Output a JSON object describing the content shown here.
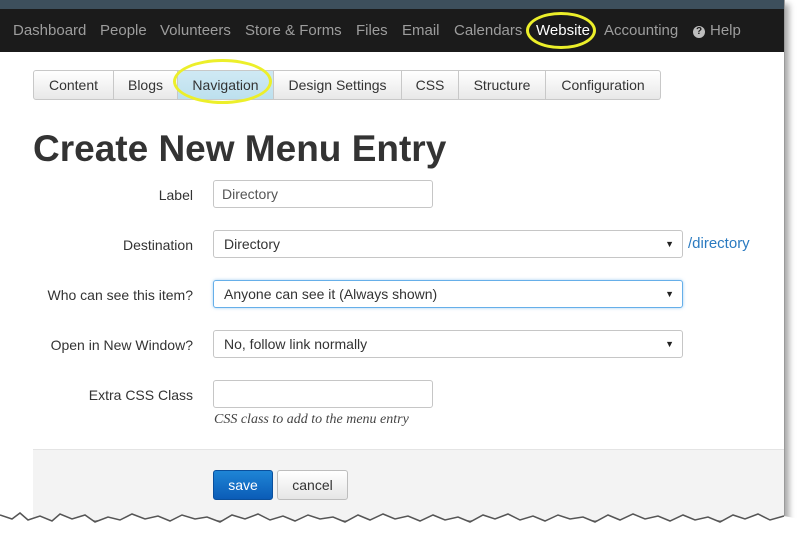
{
  "topnav": {
    "items": [
      "Dashboard",
      "People",
      "Volunteers",
      "Store & Forms",
      "Files",
      "Email",
      "Calendars",
      "Website",
      "Accounting",
      "Help"
    ]
  },
  "tabs": [
    "Content",
    "Blogs",
    "Navigation",
    "Design Settings",
    "CSS",
    "Structure",
    "Configuration"
  ],
  "page": {
    "title": "Create New Menu Entry"
  },
  "form": {
    "label": {
      "label": "Label",
      "value": "Directory"
    },
    "destination": {
      "label": "Destination",
      "value": "Directory",
      "link": "/directory"
    },
    "visibility": {
      "label": "Who can see this item?",
      "value": "Anyone can see it (Always shown)"
    },
    "new_window": {
      "label": "Open in New Window?",
      "value": "No, follow link normally"
    },
    "css_class": {
      "label": "Extra CSS Class",
      "value": "",
      "help": "CSS class to add to the menu entry"
    }
  },
  "buttons": {
    "save": "save",
    "cancel": "cancel"
  },
  "colors": {
    "nav_bg": "#1b1b1b",
    "highlight_ring": "#ecef2a",
    "link": "#2a7ac0",
    "primary": "#0b5cb7"
  }
}
